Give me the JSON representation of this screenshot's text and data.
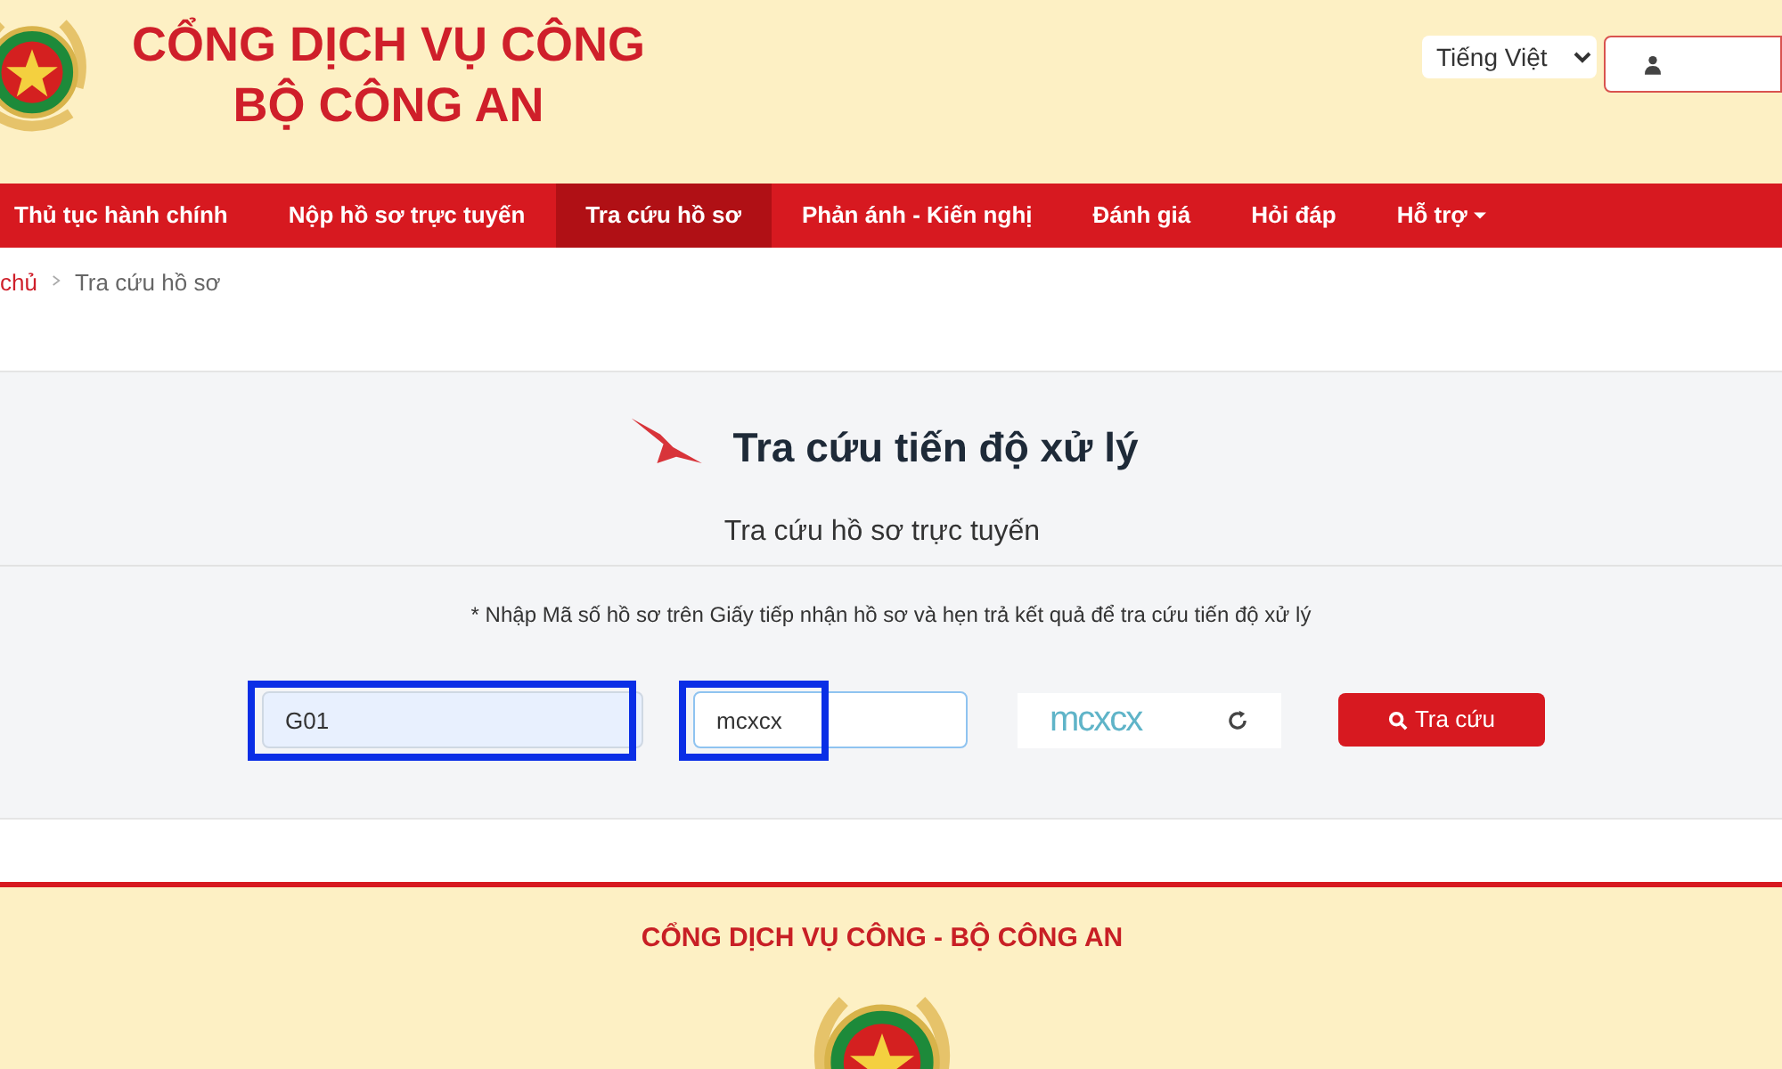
{
  "header": {
    "title_line_1": "CỔNG DỊCH VỤ CÔNG",
    "title_line_2": "BỘ CÔNG AN",
    "language": "Tiếng Việt"
  },
  "nav": [
    {
      "label": "Thủ tục hành chính",
      "selected": false,
      "dropdown": false
    },
    {
      "label": "Nộp hồ sơ trực tuyến",
      "selected": false,
      "dropdown": false
    },
    {
      "label": "Tra cứu hồ sơ",
      "selected": true,
      "dropdown": false
    },
    {
      "label": "Phản ánh - Kiến nghị",
      "selected": false,
      "dropdown": false
    },
    {
      "label": "Đánh giá",
      "selected": false,
      "dropdown": false
    },
    {
      "label": "Hỏi đáp",
      "selected": false,
      "dropdown": false
    },
    {
      "label": "Hỗ trợ",
      "selected": false,
      "dropdown": true
    }
  ],
  "breadcrumb": [
    "chủ",
    "Tra cứu hồ sơ"
  ],
  "search": {
    "title": "Tra cứu tiến độ xử lý",
    "subtitle": "Tra cứu hồ sơ trực tuyến",
    "note": "* Nhập Mã số hồ sơ trên Giấy tiếp nhận hồ sơ và hẹn trả kết quả để tra cứu tiến độ xử lý",
    "code_field": {
      "value": "G01",
      "highlighted": true
    },
    "captcha_field": {
      "value": "mcxcx",
      "highlighted": true
    },
    "captcha_image": "mcxcx",
    "button": "Tra cứu"
  },
  "footer": {
    "title": "CỔNG DỊCH VỤ CÔNG - BỘ CÔNG AN"
  }
}
